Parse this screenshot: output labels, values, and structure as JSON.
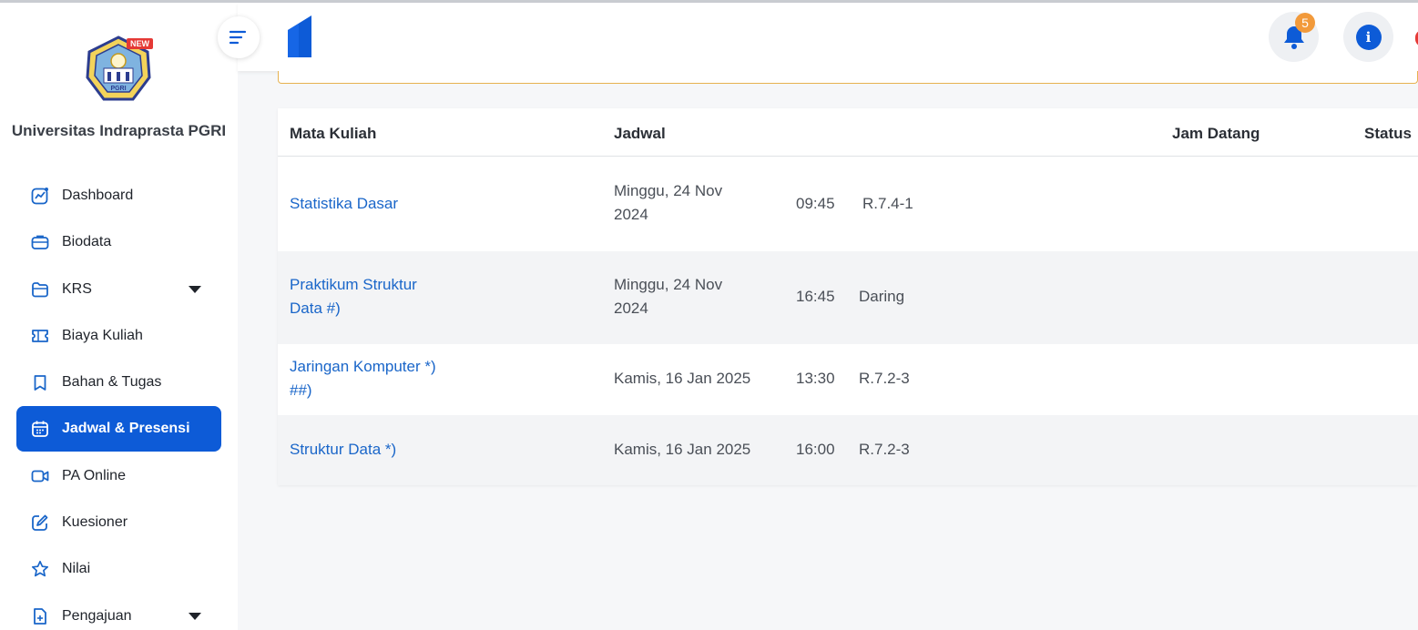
{
  "university_name": "Universitas Indraprasta PGRI",
  "logo_badge": "NEW",
  "logo_text": "PGRI",
  "nav": [
    {
      "label": "Dashboard",
      "icon": "chart-icon",
      "active": false,
      "caret": false
    },
    {
      "label": "Biodata",
      "icon": "briefcase-icon",
      "active": false,
      "caret": false
    },
    {
      "label": "KRS",
      "icon": "folder-icon",
      "active": false,
      "caret": true
    },
    {
      "label": "Biaya Kuliah",
      "icon": "ticket-icon",
      "active": false,
      "caret": false
    },
    {
      "label": "Bahan & Tugas",
      "icon": "bookmark-icon",
      "active": false,
      "caret": false
    },
    {
      "label": "Jadwal & Presensi",
      "icon": "calendar-icon",
      "active": true,
      "caret": false
    },
    {
      "label": "PA Online",
      "icon": "video-icon",
      "active": false,
      "caret": false
    },
    {
      "label": "Kuesioner",
      "icon": "edit-icon",
      "active": false,
      "caret": false
    },
    {
      "label": "Nilai",
      "icon": "star-icon",
      "active": false,
      "caret": false
    },
    {
      "label": "Pengajuan",
      "icon": "document-add-icon",
      "active": false,
      "caret": true
    }
  ],
  "topbar": {
    "notification_count": "5",
    "info_label": "i"
  },
  "table": {
    "headers": {
      "course": "Mata Kuliah",
      "schedule": "Jadwal",
      "arrival": "Jam Datang",
      "status": "Status"
    },
    "rows": [
      {
        "course": [
          "Statistika Dasar"
        ],
        "date": [
          "Minggu, 24 Nov",
          "2024"
        ],
        "time": "09:45",
        "room": "R.7.4-1"
      },
      {
        "course": [
          "Praktikum Struktur",
          "Data #)"
        ],
        "date": [
          "Minggu, 24 Nov",
          "2024"
        ],
        "time": "16:45",
        "room": "Daring"
      },
      {
        "course": [
          "Jaringan Komputer *)",
          "##)"
        ],
        "date": [
          "Kamis, 16 Jan 2025"
        ],
        "time": "13:30",
        "room": "R.7.2-3"
      },
      {
        "course": [
          "Struktur Data *)"
        ],
        "date": [
          "Kamis, 16 Jan 2025"
        ],
        "time": "16:00",
        "room": "R.7.2-3"
      }
    ]
  },
  "colors": {
    "primary": "#0d5bd7",
    "link": "#1a66c9",
    "badge": "#f29a3b",
    "alert_border": "#e7b24f"
  }
}
